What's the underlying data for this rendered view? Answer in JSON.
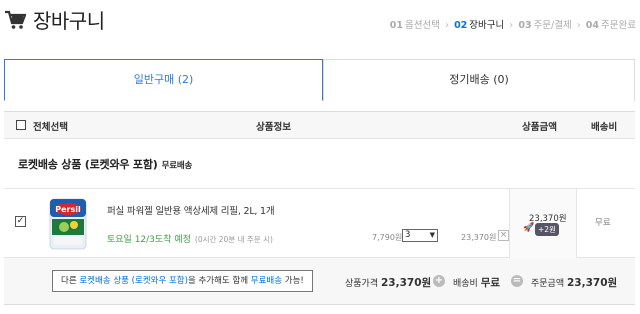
{
  "header": {
    "title": "장바구니",
    "steps": [
      {
        "num": "01",
        "label": "옵션선택",
        "current": false
      },
      {
        "num": "02",
        "label": "장바구니",
        "current": true
      },
      {
        "num": "03",
        "label": "주문/결제",
        "current": false
      },
      {
        "num": "04",
        "label": "주문완료",
        "current": false
      }
    ]
  },
  "tabs": [
    {
      "label": "일반구매 (2)",
      "active": true
    },
    {
      "label": "정기배송 (0)",
      "active": false
    }
  ],
  "table_header": {
    "select_all": "전체선택",
    "product_info": "상품정보",
    "amount": "상품금액",
    "shipping": "배송비"
  },
  "group": {
    "title": "로켓배송 상품 (로켓와우 포함)",
    "sub": "무료배송"
  },
  "item": {
    "checked": true,
    "checkmark": "✓",
    "image_alt": "퍼실 파워젤 세제",
    "image_brand": "Persil",
    "name": "퍼실 파워젤 일반용 액상세제 리필, 2L, 1개",
    "delivery": "토요일 12/3도착 예정",
    "delivery_note": "(0시간 20분 내 주문 시)",
    "unit_price": "7,790원",
    "quantity": "3",
    "line_price": "23,370원",
    "remove": "×",
    "amount": "23,370원",
    "points_badge": "+2원",
    "shipping": "무료"
  },
  "summary": {
    "notice_prefix": "다른 ",
    "notice_link": "로켓배송 상품 (로켓와우 포함)",
    "notice_mid": "을 추가해도 함께 ",
    "notice_free": "무료배송",
    "notice_suffix": " 가능!",
    "product_price_label": "상품가격",
    "product_price": "23,370원",
    "plus": "+",
    "shipping_label": "배송비",
    "shipping_value": "무료",
    "equals": "=",
    "total_label": "주문금액",
    "total": "23,370원"
  },
  "colors": {
    "accent": "#0073e9",
    "tab_border": "#2f7bd9",
    "delivery_green": "#43a047"
  },
  "icons": {
    "cart": "cart-icon",
    "rocket": "rocket-icon"
  }
}
